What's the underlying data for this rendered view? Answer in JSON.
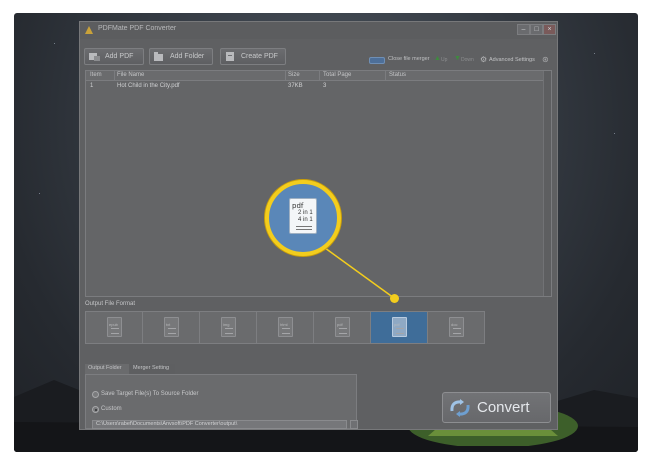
{
  "window": {
    "title": "PDFMate PDF Converter"
  },
  "toolbar": {
    "add_pdf": "Add PDF",
    "add_folder": "Add Folder",
    "create_pdf": "Create PDF",
    "close_merger": "Close file merger",
    "up": "Up",
    "down": "Down",
    "advanced_settings": "Advanced Settings"
  },
  "table": {
    "headers": [
      "Item",
      "File Name",
      "Size",
      "Total Page",
      "Status"
    ],
    "rows": [
      {
        "item": "1",
        "file_name": "Hot Child in the City.pdf",
        "size": "37KB",
        "total_page": "3",
        "status": ""
      }
    ]
  },
  "output_format": {
    "label": "Output File Format",
    "formats": [
      {
        "id": "epub",
        "tag": "epub",
        "selected": false
      },
      {
        "id": "text",
        "tag": "txt",
        "selected": false
      },
      {
        "id": "image",
        "tag": "img",
        "selected": false
      },
      {
        "id": "html",
        "tag": "html",
        "selected": false
      },
      {
        "id": "pdf",
        "tag": "pdf",
        "selected": false
      },
      {
        "id": "pdf-2in1",
        "tag": "pdf",
        "selected": true
      },
      {
        "id": "doc",
        "tag": "doc",
        "selected": false
      }
    ]
  },
  "callout": {
    "icon_tag": "pdf",
    "line1": "2 in 1",
    "line2": "4 in 1",
    "color": "#f3cd1d"
  },
  "bottom_tabs": {
    "output_folder": "Output Folder",
    "merger_setting": "Merger Setting"
  },
  "output_folder": {
    "option_source": "Save Target File(s) To Source Folder",
    "option_custom": "Custom",
    "custom_selected": true,
    "path": "C:\\Users\\rabef\\Documents\\Anvsoft\\PDF Converter\\output\\"
  },
  "convert": {
    "label": "Convert"
  },
  "colors": {
    "accent": "#3f6d99",
    "highlight": "#f3cd1d"
  }
}
